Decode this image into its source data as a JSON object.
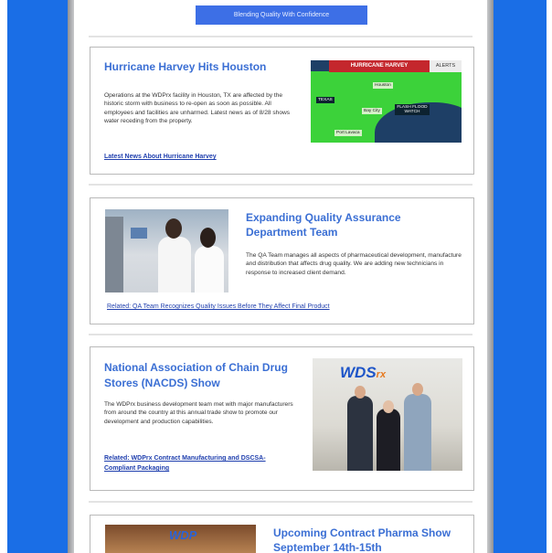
{
  "header": {
    "cta_label": "Blending Quality With Confidence"
  },
  "articles": [
    {
      "title": "Hurricane Harvey Hits Houston",
      "body": "Operations at the WDPrx facility in Houston, TX are affected by the historic storm with business to re-open as soon as possible.  All employees and facilities are unharmed.  Latest news as of 8/28 shows water receding from the property.",
      "link": "Latest News About Hurricane Harvey",
      "image": {
        "banner": "HURRICANE HARVEY",
        "alerts": "ALERTS",
        "labels": [
          "TEXAS",
          "Houston",
          "Bay City",
          "FLASH FLOOD WATCH",
          "Port Lavaca"
        ]
      }
    },
    {
      "title": "Expanding Quality Assurance Department Team",
      "body": "The QA Team manages all aspects of pharmaceutical development, manufacture and distribution that affects drug quality.  We are adding new technicians in response to increased client demand.",
      "link": "Related: QA Team Recognizes Quality Issues Before They Affect Final Product"
    },
    {
      "title": "National Association of Chain Drug Stores (NACDS) Show",
      "body": "The WDPrx business development team met with major manufacturers from around the country at this annual trade show to promote our development and production capabilities.",
      "link": "Related: WDPrx Contract Manufacturing and DSCSA-Compliant Packaging",
      "image": {
        "logo": "WDS",
        "logo_suffix": "rx"
      }
    },
    {
      "title": "Upcoming Contract Pharma Show September 14th-15th",
      "image": {
        "logo": "WDP"
      }
    }
  ],
  "colors": {
    "brand_blue": "#1a6ee6",
    "title_blue": "#3b6fd4",
    "link_blue": "#1f3fae",
    "alert_red": "#c4272d"
  }
}
